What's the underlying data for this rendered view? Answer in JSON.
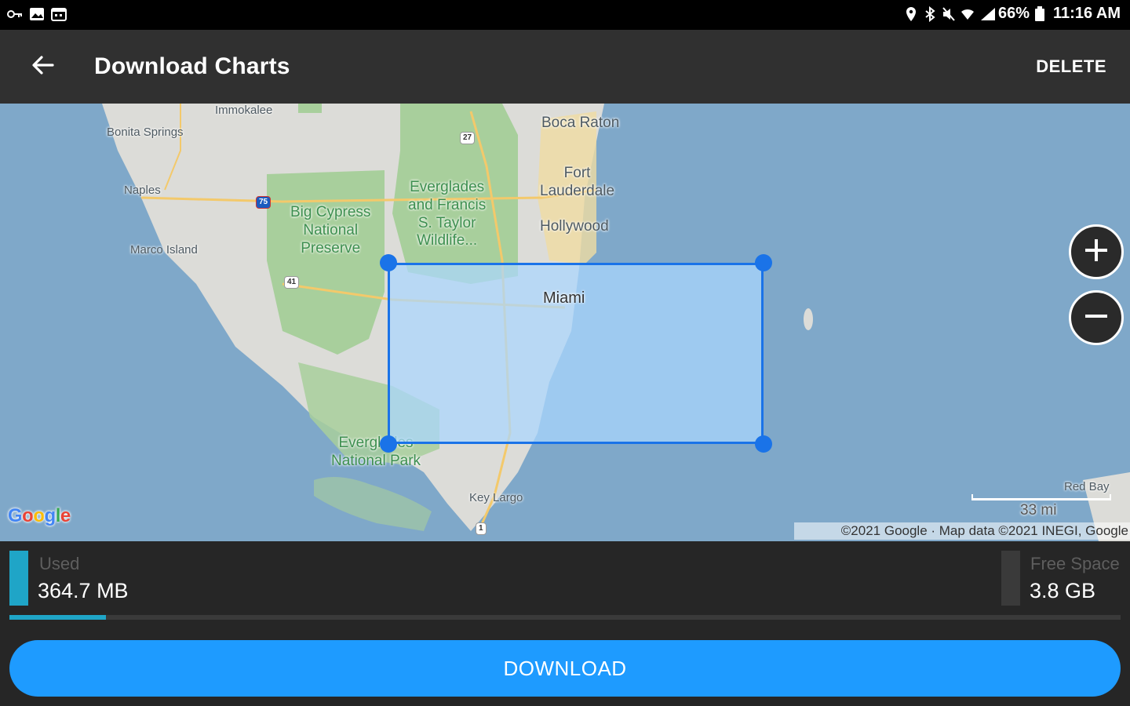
{
  "status_bar": {
    "left_icons": [
      "vpn-key-icon",
      "image-icon",
      "calendar-icon"
    ],
    "right_icons": [
      "location-icon",
      "bluetooth-icon",
      "mute-icon",
      "wifi-icon",
      "signal-icon",
      "battery-icon"
    ],
    "battery": "66%",
    "time": "11:16 AM"
  },
  "app_bar": {
    "title": "Download Charts",
    "back_icon": "arrow-left-icon",
    "delete_label": "DELETE"
  },
  "map": {
    "labels": {
      "immokalee": "Immokalee",
      "bonita_springs": "Bonita Springs",
      "naples": "Naples",
      "marco_island": "Marco Island",
      "big_cypress": "Big Cypress\nNational\nPreserve",
      "everglades_francis": "Everglades\nand Francis\nS. Taylor\nWildlife...",
      "boca_raton": "Boca Raton",
      "fort_lauderdale": "Fort\nLauderdale",
      "hollywood": "Hollywood",
      "miami": "Miami",
      "everglades_np": "Everglades\nNational Park",
      "key_largo": "Key Largo",
      "red_bay": "Red Bay"
    },
    "shields": {
      "r27": "27",
      "r75": "75",
      "r41": "41",
      "r1": "1"
    },
    "zoom_in_icon": "plus-icon",
    "zoom_out_icon": "minus-icon",
    "logo": [
      "G",
      "o",
      "o",
      "g",
      "l",
      "e"
    ],
    "logo_colors": [
      "#4285f4",
      "#ea4335",
      "#fbbc05",
      "#4285f4",
      "#34a853",
      "#ea4335"
    ],
    "scale_label": "33 mi",
    "attribution": "©2021 Google · Map data ©2021 INEGI, Google",
    "selection_color": "#1a73e8"
  },
  "storage": {
    "used_label": "Used",
    "used_value": "364.7 MB",
    "free_label": "Free Space",
    "free_value": "3.8 GB",
    "used_fraction": 0.087,
    "used_color": "#1fa5c7"
  },
  "download_label": "DOWNLOAD"
}
